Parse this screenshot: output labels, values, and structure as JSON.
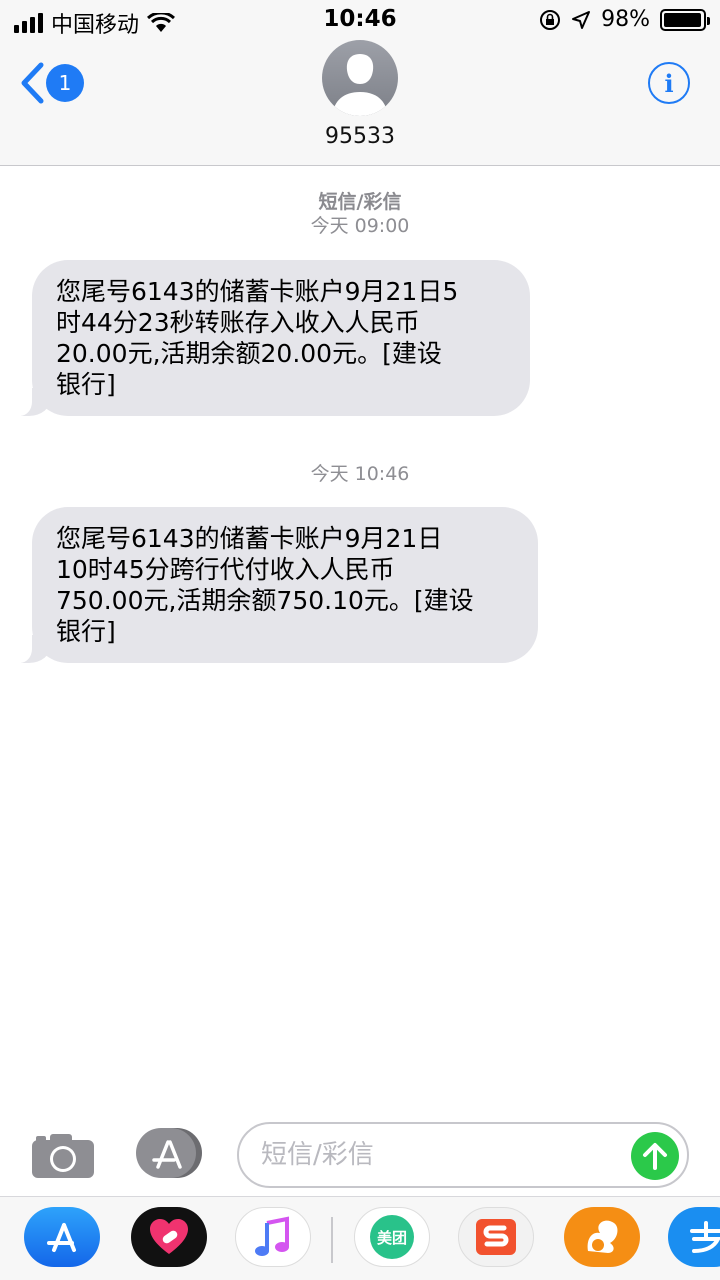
{
  "status_bar": {
    "carrier": "中国移动",
    "time": "10:46",
    "battery_percent": "98%",
    "battery_level": 0.98
  },
  "header": {
    "back_badge": "1",
    "contact": "95533",
    "info_label": "i"
  },
  "messages": [
    {
      "type_label": "短信/彩信",
      "timestamp": "今天 09:00",
      "text": "您尾号6143的储蓄卡账户9月21日5\n时44分23秒转账存入收入人民币\n20.00元,活期余额20.00元。[建设\n银行]"
    },
    {
      "timestamp": "今天 10:46",
      "text": "您尾号6143的储蓄卡账户9月21日\n10时45分跨行代付收入人民币\n750.00元,活期余额750.10元。[建设\n银行]"
    }
  ],
  "compose": {
    "placeholder": "短信/彩信"
  },
  "drawer": {
    "meituan_label": "美团"
  },
  "colors": {
    "accent": "#1f7bf5",
    "send": "#2bc94a",
    "bubble": "#e5e5ea"
  }
}
